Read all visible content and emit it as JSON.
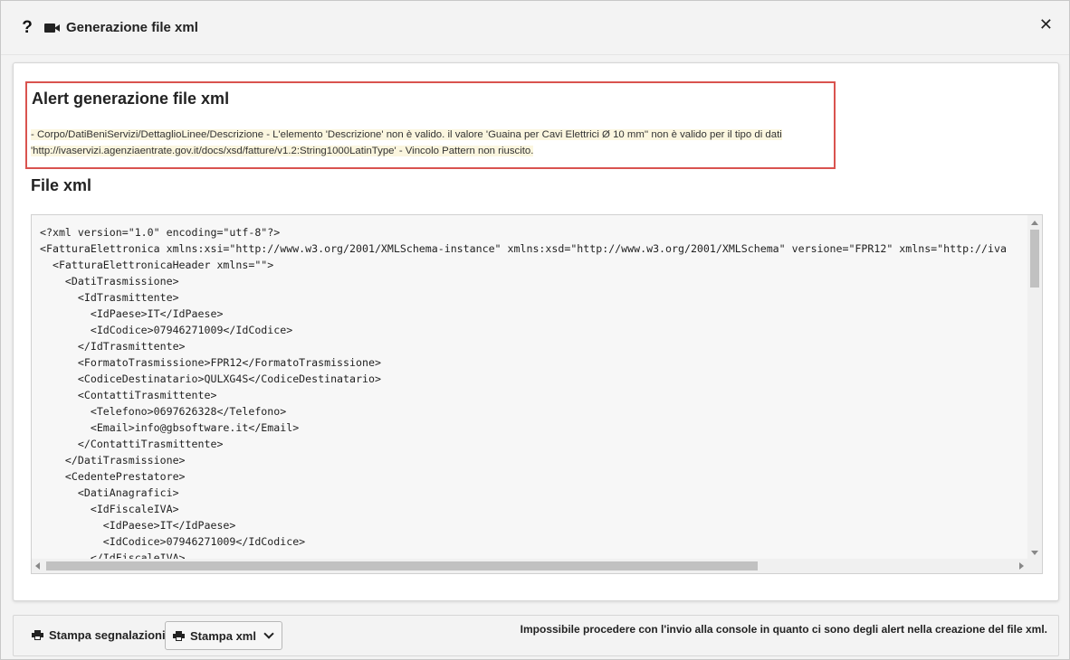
{
  "window": {
    "title": "Generazione file xml",
    "help_glyph": "?",
    "close_glyph": "✕",
    "icons": [
      "question-icon",
      "video-camera-icon",
      "close-icon"
    ]
  },
  "alert": {
    "title": "Alert generazione file xml",
    "message_line1": "- Corpo/DatiBeniServizi/DettaglioLinee/Descrizione - L'elemento 'Descrizione' non è valido. il valore 'Guaina per Cavi Elettrici Ø 10 mm'' non è valido per il tipo di dati",
    "message_line2": "'http://ivaservizi.agenziaentrate.gov.it/docs/xsd/fatture/v1.2:String1000LatinType' - Vincolo Pattern non riuscito.",
    "border_color": "#d9534f",
    "highlight_color": "#fbf6df"
  },
  "xml_section": {
    "title": "File xml",
    "lines": [
      "<?xml version=\"1.0\" encoding=\"utf-8\"?>",
      "<FatturaElettronica xmlns:xsi=\"http://www.w3.org/2001/XMLSchema-instance\" xmlns:xsd=\"http://www.w3.org/2001/XMLSchema\" versione=\"FPR12\" xmlns=\"http://iva",
      "  <FatturaElettronicaHeader xmlns=\"\">",
      "    <DatiTrasmissione>",
      "      <IdTrasmittente>",
      "        <IdPaese>IT</IdPaese>",
      "        <IdCodice>07946271009</IdCodice>",
      "      </IdTrasmittente>",
      "      <FormatoTrasmissione>FPR12</FormatoTrasmissione>",
      "      <CodiceDestinatario>QULXG4S</CodiceDestinatario>",
      "      <ContattiTrasmittente>",
      "        <Telefono>0697626328</Telefono>",
      "        <Email>info@gbsoftware.it</Email>",
      "      </ContattiTrasmittente>",
      "    </DatiTrasmissione>",
      "    <CedentePrestatore>",
      "      <DatiAnagrafici>",
      "        <IdFiscaleIVA>",
      "          <IdPaese>IT</IdPaese>",
      "          <IdCodice>07946271009</IdCodice>",
      "        </IdFiscaleIVA>"
    ]
  },
  "footer": {
    "print_reports_label": "Stampa segnalazioni",
    "print_xml_label": "Stampa xml",
    "message": "Impossibile procedere con l'invio alla console in quanto ci sono degli alert nella creazione del file xml."
  }
}
